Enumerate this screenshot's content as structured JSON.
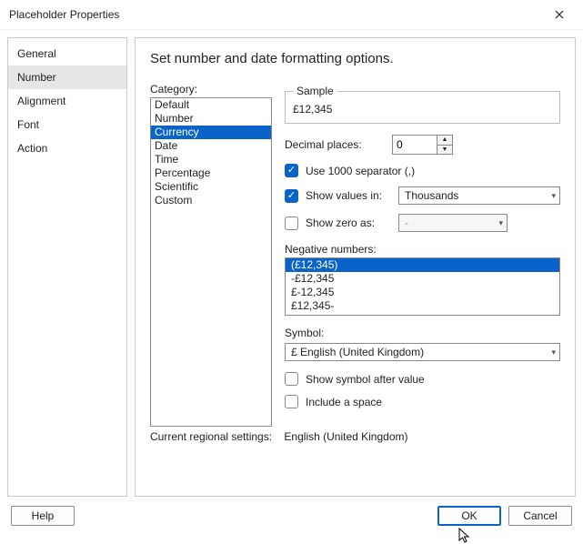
{
  "window": {
    "title": "Placeholder Properties"
  },
  "sidebar": {
    "items": [
      {
        "label": "General"
      },
      {
        "label": "Number"
      },
      {
        "label": "Alignment"
      },
      {
        "label": "Font"
      },
      {
        "label": "Action"
      }
    ],
    "selected_index": 1
  },
  "main": {
    "heading": "Set number and date formatting options.",
    "category_label": "Category:",
    "categories": [
      "Default",
      "Number",
      "Currency",
      "Date",
      "Time",
      "Percentage",
      "Scientific",
      "Custom"
    ],
    "category_selected_index": 2,
    "sample": {
      "legend": "Sample",
      "value": "£12,345"
    },
    "decimal_places": {
      "label": "Decimal places:",
      "value": "0"
    },
    "use_separator": {
      "label": "Use 1000 separator (,)",
      "checked": true
    },
    "show_values_in": {
      "label": "Show values in:",
      "checked": true,
      "value": "Thousands"
    },
    "show_zero_as": {
      "label": "Show zero as:",
      "checked": false,
      "value": "-"
    },
    "negative_numbers": {
      "label": "Negative numbers:",
      "options": [
        "(£12,345)",
        "-£12,345",
        "£-12,345",
        "£12,345-"
      ],
      "selected_index": 0
    },
    "symbol": {
      "label": "Symbol:",
      "value": "£ English (United Kingdom)"
    },
    "show_symbol_after_value": {
      "label": "Show symbol after value",
      "checked": false
    },
    "include_space": {
      "label": "Include a space",
      "checked": false
    },
    "regional_settings": {
      "label": "Current regional settings:",
      "value": "English (United Kingdom)"
    }
  },
  "buttons": {
    "help": "Help",
    "ok": "OK",
    "cancel": "Cancel"
  }
}
